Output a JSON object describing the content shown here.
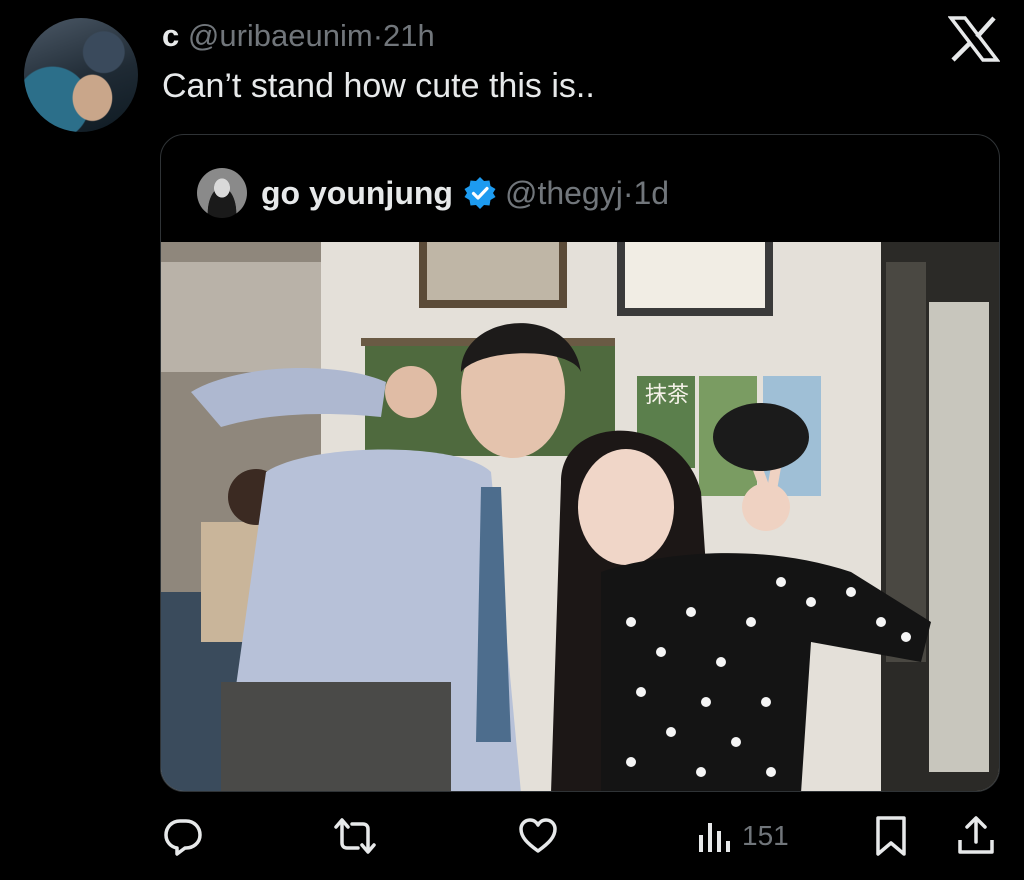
{
  "tweet": {
    "display_name": "c",
    "handle": "@uribaeunim",
    "separator": "·",
    "time": "21h",
    "text": "Can’t stand how cute this is.."
  },
  "quote": {
    "display_name": "go younjung",
    "verified": true,
    "handle": "@thegyj",
    "separator": "·",
    "time": "1d",
    "photo_sign_text": "抹茶"
  },
  "actions": {
    "views": "151"
  },
  "icons": {
    "app_logo": "x-logo-icon",
    "verified": "verified-badge-icon",
    "reply": "reply-icon",
    "repost": "repost-icon",
    "like": "like-icon",
    "views": "analytics-icon",
    "bookmark": "bookmark-icon",
    "share": "share-icon"
  },
  "colors": {
    "background": "#000000",
    "text": "#e7e9ea",
    "muted": "#71767b",
    "verified": "#1d9bf0",
    "border": "#2f3336"
  }
}
